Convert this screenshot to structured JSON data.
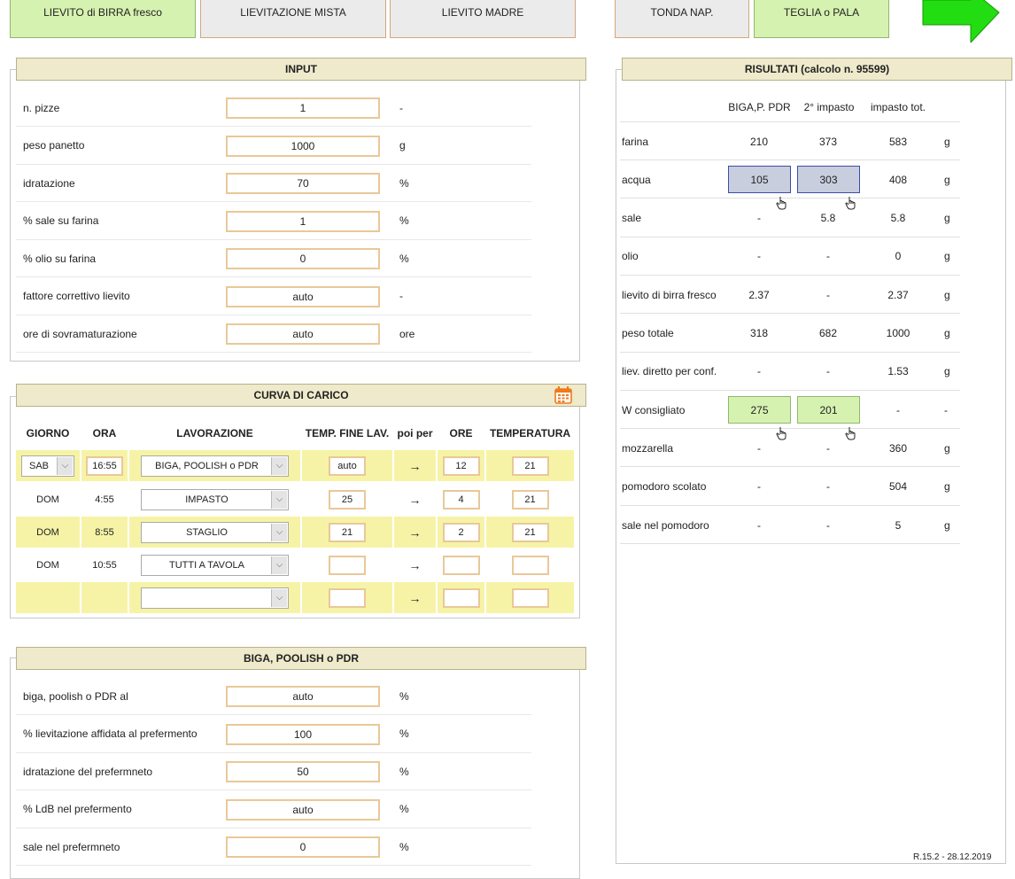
{
  "top_buttons": [
    {
      "label": "LIEVITO di BIRRA fresco",
      "state": "selected"
    },
    {
      "label": "LIEVITAZIONE MISTA",
      "state": "normal"
    },
    {
      "label": "LIEVITO MADRE",
      "state": "normal"
    },
    {
      "label": "TONDA NAP.",
      "state": "normal"
    },
    {
      "label": "TEGLIA o PALA",
      "state": "selected"
    }
  ],
  "next_arrow_icon": "right-arrow-icon",
  "colors": {
    "selected_bg": "#d6f2b0",
    "header_bg": "#eeeacb",
    "input_border": "#e9c898",
    "row_highlight": "#f6f3a6",
    "arrow": "#22dd11"
  },
  "input": {
    "title": "INPUT",
    "rows": [
      {
        "label": "n. pizze",
        "value": "1",
        "unit": "-"
      },
      {
        "label": "peso panetto",
        "value": "1000",
        "unit": "g"
      },
      {
        "label": "idratazione",
        "value": "70",
        "unit": "%"
      },
      {
        "label": "% sale su farina",
        "value": "1",
        "unit": "%"
      },
      {
        "label": "% olio su farina",
        "value": "0",
        "unit": "%"
      },
      {
        "label": "fattore correttivo lievito",
        "value": "auto",
        "unit": "-"
      },
      {
        "label": "ore di sovramaturazione",
        "value": "auto",
        "unit": "ore"
      }
    ]
  },
  "curve": {
    "title": "CURVA DI CARICO",
    "calendar_icon": "calendar-icon",
    "headers": [
      "GIORNO",
      "ORA",
      "LAVORAZIONE",
      "TEMP. FINE LAV.",
      "poi per",
      "ORE",
      "TEMPERATURA"
    ],
    "arrow_glyph": "→",
    "rows": [
      {
        "day": "SAB",
        "day_is_select": true,
        "time": "16:55",
        "time_is_input": true,
        "work": "BIGA, POOLISH o PDR",
        "temp_end": "auto",
        "hours": "12",
        "temperature": "21"
      },
      {
        "day": "DOM",
        "day_is_select": false,
        "time": "4:55",
        "time_is_input": false,
        "work": "IMPASTO",
        "temp_end": "25",
        "hours": "4",
        "temperature": "21"
      },
      {
        "day": "DOM",
        "day_is_select": false,
        "time": "8:55",
        "time_is_input": false,
        "work": "STAGLIO",
        "temp_end": "21",
        "hours": "2",
        "temperature": "21"
      },
      {
        "day": "DOM",
        "day_is_select": false,
        "time": "10:55",
        "time_is_input": false,
        "work": "TUTTI A TAVOLA",
        "temp_end": "",
        "hours": "",
        "temperature": ""
      },
      {
        "day": "",
        "day_is_select": false,
        "time": "",
        "time_is_input": false,
        "work": "",
        "temp_end": "",
        "hours": "",
        "temperature": ""
      }
    ]
  },
  "biga": {
    "title": "BIGA, POOLISH o PDR",
    "rows": [
      {
        "label": "biga, poolish o PDR al",
        "value": "auto",
        "unit": "%"
      },
      {
        "label": "% lievitazione affidata al prefermento",
        "value": "100",
        "unit": "%"
      },
      {
        "label": "idratazione del prefermneto",
        "value": "50",
        "unit": "%"
      },
      {
        "label": "% LdB nel prefermento",
        "value": "auto",
        "unit": "%"
      },
      {
        "label": "sale nel prefermneto",
        "value": "0",
        "unit": "%"
      }
    ]
  },
  "results": {
    "title": "RISULTATI (calcolo n. 95599)",
    "col_headers": [
      "BIGA,P. PDR",
      "2° impasto",
      "impasto tot."
    ],
    "rows": [
      {
        "label": "farina",
        "c1": "210",
        "c2": "373",
        "c3": "583",
        "unit": "g",
        "style": ""
      },
      {
        "label": "acqua",
        "c1": "105",
        "c2": "303",
        "c3": "408",
        "unit": "g",
        "style": "blue"
      },
      {
        "label": "sale",
        "c1": "-",
        "c2": "5.8",
        "c3": "5.8",
        "unit": "g",
        "style": ""
      },
      {
        "label": "olio",
        "c1": "-",
        "c2": "-",
        "c3": "0",
        "unit": "g",
        "style": ""
      },
      {
        "label": "lievito di birra fresco",
        "c1": "2.37",
        "c2": "-",
        "c3": "2.37",
        "unit": "g",
        "style": ""
      },
      {
        "label": "peso totale",
        "c1": "318",
        "c2": "682",
        "c3": "1000",
        "unit": "g",
        "style": ""
      },
      {
        "label": "liev. diretto per conf.",
        "c1": "-",
        "c2": "-",
        "c3": "1.53",
        "unit": "g",
        "style": ""
      },
      {
        "label": "W consigliato",
        "c1": "275",
        "c2": "201",
        "c3": "-",
        "unit": "-",
        "style": "green"
      },
      {
        "label": "mozzarella",
        "c1": "-",
        "c2": "-",
        "c3": "360",
        "unit": "g",
        "style": ""
      },
      {
        "label": "pomodoro scolato",
        "c1": "-",
        "c2": "-",
        "c3": "504",
        "unit": "g",
        "style": ""
      },
      {
        "label": "sale nel pomodoro",
        "c1": "-",
        "c2": "-",
        "c3": "5",
        "unit": "g",
        "style": ""
      }
    ],
    "version": "R.15.2 - 28.12.2019"
  }
}
